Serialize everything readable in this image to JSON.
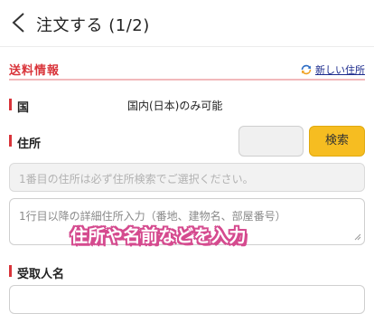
{
  "header": {
    "title": "注文する (1/2)",
    "back_icon": "chevron-left-icon"
  },
  "section": {
    "title": "送料情報",
    "new_address_link": "新しい住所",
    "new_address_icon": "refresh-icon",
    "accent_color": "#d9343a"
  },
  "country": {
    "label": "国",
    "value": "国内(日本)のみ可能"
  },
  "address": {
    "label": "住所",
    "postal_value": "",
    "search_button": "検索",
    "line1_placeholder": "1番目の住所は必ず住所検索でご選択ください。",
    "line2_placeholder": "1行目以降の詳細住所入力（番地、建物名、部屋番号）"
  },
  "overlay_caption": "住所や名前などを入力",
  "recipient": {
    "label": "受取人名",
    "value": ""
  }
}
